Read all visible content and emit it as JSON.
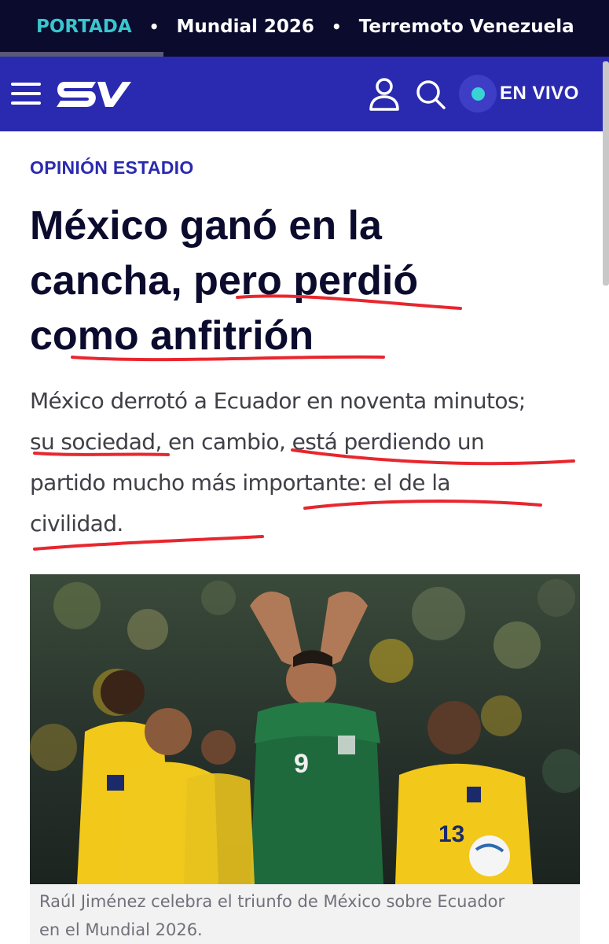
{
  "topbar": {
    "tabs": [
      {
        "label": "PORTADA"
      },
      {
        "label": "Mundial 2026"
      },
      {
        "label": "Terremoto Venezuela"
      }
    ],
    "separator": "•"
  },
  "header": {
    "live_label": "EN VIVO",
    "icons": [
      "menu-icon",
      "ecuavisa-logo",
      "user-icon",
      "search-icon",
      "live-dot-icon"
    ],
    "brand_color": "#2a2ab0",
    "live_dot_color": "#39d3d3"
  },
  "article": {
    "kicker": "OPINIÓN ESTADIO",
    "headline_lines": [
      "México ganó en la",
      "cancha, pero perdió",
      "como anfitrión"
    ],
    "lead_lines": [
      "México derrotó a Ecuador en noventa minutos;",
      "su sociedad, en cambio, está perdiendo un",
      "partido mucho más importante: el de la",
      "civilidad."
    ],
    "image_alt": "Raúl Jiménez celebra el triunfo de México sobre Ecuador en el Mundial 2026.",
    "caption_lines": [
      "Raúl Jiménez celebra el triunfo de México sobre Ecuador",
      "en el Mundial 2026."
    ]
  },
  "colors": {
    "topbar_bg": "#0b0b2e",
    "active_tab": "#39c6cd",
    "kicker": "#2a2ab0",
    "annotation": "#e8262e"
  }
}
